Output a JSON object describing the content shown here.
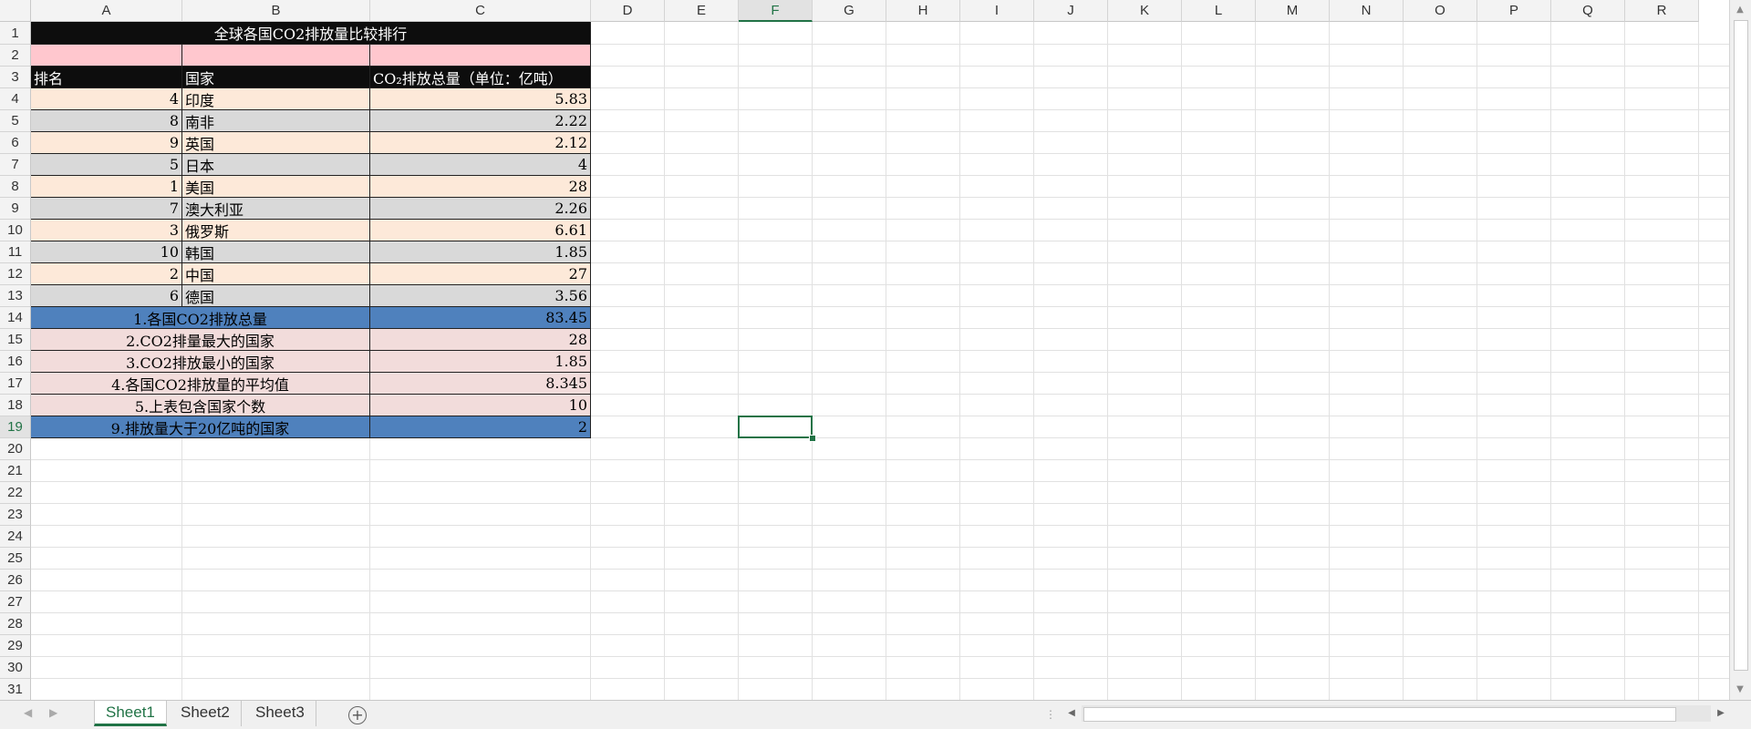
{
  "columns": [
    "A",
    "B",
    "C",
    "D",
    "E",
    "F",
    "G",
    "H",
    "I",
    "J",
    "K",
    "L",
    "M",
    "N",
    "O",
    "P",
    "Q",
    "R"
  ],
  "rows": [
    1,
    2,
    3,
    4,
    5,
    6,
    7,
    8,
    9,
    10,
    11,
    12,
    13,
    14,
    15,
    16,
    17,
    18,
    19,
    20,
    21,
    22,
    23,
    24,
    25,
    26,
    27,
    28,
    29,
    30,
    31
  ],
  "selected_column": "F",
  "selected_row": 19,
  "title": "全球各国CO2排放量比较排行",
  "headers": {
    "rank": "排名",
    "country": "国家",
    "total": "CO₂排放总量（单位：亿吨）"
  },
  "data_rows": [
    {
      "rank": "4",
      "country": "印度",
      "value": "5.83"
    },
    {
      "rank": "8",
      "country": "南非",
      "value": "2.22"
    },
    {
      "rank": "9",
      "country": "英国",
      "value": "2.12"
    },
    {
      "rank": "5",
      "country": "日本",
      "value": "4"
    },
    {
      "rank": "1",
      "country": "美国",
      "value": "28"
    },
    {
      "rank": "7",
      "country": "澳大利亚",
      "value": "2.26"
    },
    {
      "rank": "3",
      "country": "俄罗斯",
      "value": "6.61"
    },
    {
      "rank": "10",
      "country": "韩国",
      "value": "1.85"
    },
    {
      "rank": "2",
      "country": "中国",
      "value": "27"
    },
    {
      "rank": "6",
      "country": "德国",
      "value": "3.56"
    }
  ],
  "summary_rows": [
    {
      "label": "1.各国CO2排放总量",
      "value": "83.45"
    },
    {
      "label": "2.CO2排量最大的国家",
      "value": "28"
    },
    {
      "label": "3.CO2排放最小的国家",
      "value": "1.85"
    },
    {
      "label": "4.各国CO2排放量的平均值",
      "value": "8.345"
    },
    {
      "label": "5.上表包含国家个数",
      "value": "10"
    },
    {
      "label": "9.排放量大于20亿吨的国家",
      "value": "2"
    }
  ],
  "sheet_tabs": [
    "Sheet1",
    "Sheet2",
    "Sheet3"
  ],
  "active_tab": "Sheet1",
  "add_sheet_icon": "+",
  "colors": {
    "accent": "#217346",
    "title_bg": "#0d0d0d",
    "row2_bg": "#ffc7ce",
    "peach": "#fde9d9",
    "gray": "#d9d9d9",
    "blue": "#4f81bd",
    "rose": "#f2dcdb"
  }
}
